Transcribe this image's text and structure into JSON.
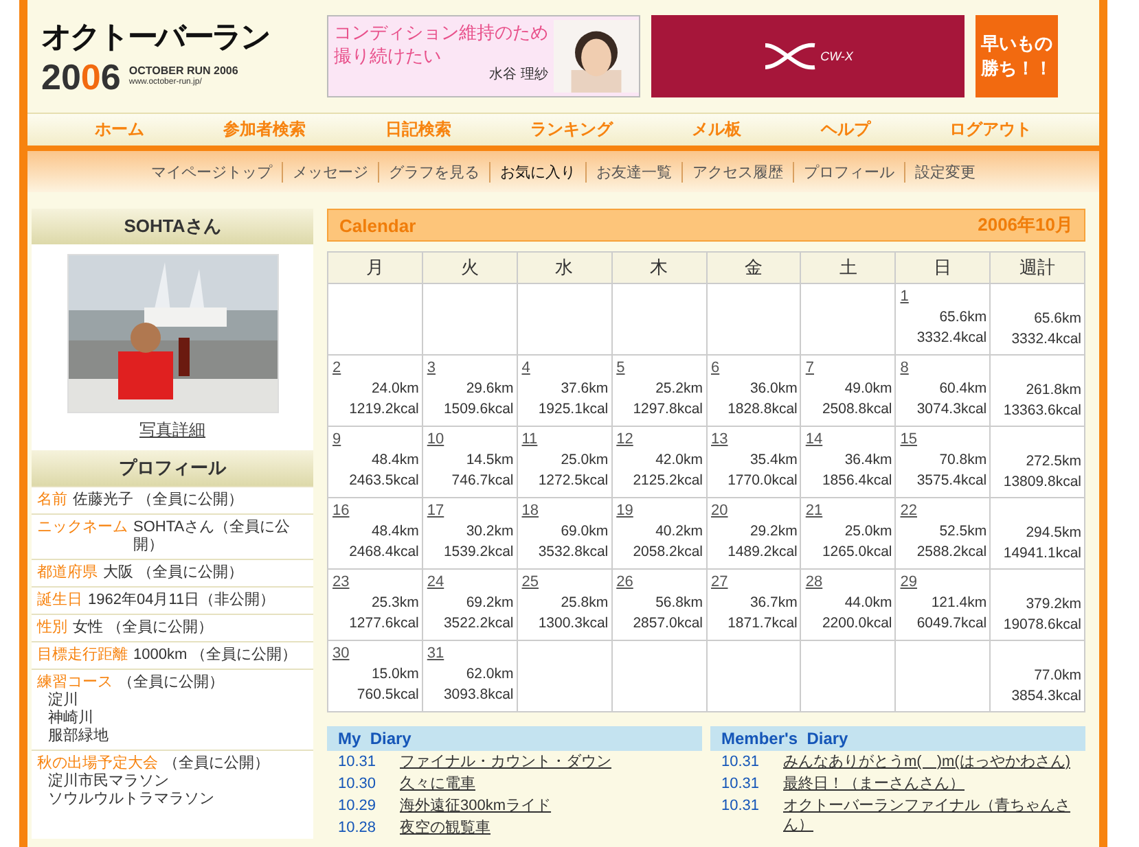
{
  "header": {
    "logo": {
      "title": "オクトーバーラン",
      "year_a": "20",
      "year_b": "0",
      "year_c": "6",
      "subtitle": "OCTOBER RUN 2006",
      "url": "www.october-run.jp/"
    },
    "ads": [
      {
        "kind": "photo_ad",
        "line1": "コンディション維持のため",
        "line2": "撮り続けたい",
        "name": "水谷 理紗"
      },
      {
        "kind": "brand_ad",
        "text": "CW-X"
      },
      {
        "kind": "promo_ad",
        "line1": "早いもの",
        "line2": "勝ち！！"
      }
    ]
  },
  "nav": [
    "ホーム",
    "参加者検索",
    "日記検索",
    "ランキング",
    "メル板",
    "ヘルプ",
    "ログアウト"
  ],
  "subnav": [
    {
      "label": "マイページトップ",
      "selected": false
    },
    {
      "label": "メッセージ",
      "selected": false
    },
    {
      "label": "グラフを見る",
      "selected": false
    },
    {
      "label": "お気に入り",
      "selected": true
    },
    {
      "label": "お友達一覧",
      "selected": false
    },
    {
      "label": "アクセス履歴",
      "selected": false
    },
    {
      "label": "プロフィール",
      "selected": false
    },
    {
      "label": "設定変更",
      "selected": false
    }
  ],
  "sidebar": {
    "user_title": "SOHTAさん",
    "photo_link": "写真詳細",
    "profile_title": "プロフィール",
    "profile": [
      {
        "label": "名前",
        "value": "佐藤光子 （全員に公開）"
      },
      {
        "label": "ニックネーム",
        "value": "SOHTAさん（全員に公開）"
      },
      {
        "label": "都道府県",
        "value": "大阪 （全員に公開）"
      },
      {
        "label": "誕生日",
        "value": "1962年04月11日（非公開）"
      },
      {
        "label": "性別",
        "value": "女性 （全員に公開）"
      },
      {
        "label": "目標走行距離",
        "value": "1000km （全員に公開）"
      },
      {
        "label": "練習コース",
        "value": "（全員に公開）",
        "lines": [
          "淀川",
          "神崎川",
          "服部緑地"
        ]
      },
      {
        "label": "秋の出場予定大会",
        "value": "（全員に公開）",
        "lines": [
          "淀川市民マラソン",
          "ソウルウルトラマラソン"
        ]
      }
    ]
  },
  "calendar": {
    "title": "Calendar",
    "month": "2006年10月",
    "columns": [
      "月",
      "火",
      "水",
      "木",
      "金",
      "土",
      "日",
      "週計"
    ],
    "weeks": [
      {
        "days": [
          {
            "kind": "blank"
          },
          {
            "kind": "blank"
          },
          {
            "kind": "blank"
          },
          {
            "kind": "blank"
          },
          {
            "kind": "blank"
          },
          {
            "kind": "blank"
          },
          {
            "kind": "day",
            "day": "1",
            "km": "65.6km",
            "kcal": "3332.4kcal"
          }
        ],
        "total": {
          "km": "65.6km",
          "kcal": "3332.4kcal"
        }
      },
      {
        "days": [
          {
            "day": "2",
            "km": "24.0km",
            "kcal": "1219.2kcal"
          },
          {
            "day": "3",
            "km": "29.6km",
            "kcal": "1509.6kcal"
          },
          {
            "day": "4",
            "km": "37.6km",
            "kcal": "1925.1kcal"
          },
          {
            "day": "5",
            "km": "25.2km",
            "kcal": "1297.8kcal"
          },
          {
            "day": "6",
            "km": "36.0km",
            "kcal": "1828.8kcal"
          },
          {
            "day": "7",
            "km": "49.0km",
            "kcal": "2508.8kcal"
          },
          {
            "day": "8",
            "km": "60.4km",
            "kcal": "3074.3kcal"
          }
        ],
        "total": {
          "km": "261.8km",
          "kcal": "13363.6kcal"
        }
      },
      {
        "days": [
          {
            "day": "9",
            "km": "48.4km",
            "kcal": "2463.5kcal"
          },
          {
            "day": "10",
            "km": "14.5km",
            "kcal": "746.7kcal"
          },
          {
            "day": "11",
            "km": "25.0km",
            "kcal": "1272.5kcal"
          },
          {
            "day": "12",
            "km": "42.0km",
            "kcal": "2125.2kcal"
          },
          {
            "day": "13",
            "km": "35.4km",
            "kcal": "1770.0kcal"
          },
          {
            "day": "14",
            "km": "36.4km",
            "kcal": "1856.4kcal"
          },
          {
            "day": "15",
            "km": "70.8km",
            "kcal": "3575.4kcal"
          }
        ],
        "total": {
          "km": "272.5km",
          "kcal": "13809.8kcal"
        }
      },
      {
        "days": [
          {
            "day": "16",
            "km": "48.4km",
            "kcal": "2468.4kcal"
          },
          {
            "day": "17",
            "km": "30.2km",
            "kcal": "1539.2kcal"
          },
          {
            "day": "18",
            "km": "69.0km",
            "kcal": "3532.8kcal"
          },
          {
            "day": "19",
            "km": "40.2km",
            "kcal": "2058.2kcal"
          },
          {
            "day": "20",
            "km": "29.2km",
            "kcal": "1489.2kcal"
          },
          {
            "day": "21",
            "km": "25.0km",
            "kcal": "1265.0kcal"
          },
          {
            "day": "22",
            "km": "52.5km",
            "kcal": "2588.2kcal"
          }
        ],
        "total": {
          "km": "294.5km",
          "kcal": "14941.1kcal"
        }
      },
      {
        "days": [
          {
            "day": "23",
            "km": "25.3km",
            "kcal": "1277.6kcal"
          },
          {
            "day": "24",
            "km": "69.2km",
            "kcal": "3522.2kcal"
          },
          {
            "day": "25",
            "km": "25.8km",
            "kcal": "1300.3kcal"
          },
          {
            "day": "26",
            "km": "56.8km",
            "kcal": "2857.0kcal"
          },
          {
            "day": "27",
            "km": "36.7km",
            "kcal": "1871.7kcal"
          },
          {
            "day": "28",
            "km": "44.0km",
            "kcal": "2200.0kcal"
          },
          {
            "day": "29",
            "km": "121.4km",
            "kcal": "6049.7kcal"
          }
        ],
        "total": {
          "km": "379.2km",
          "kcal": "19078.6kcal"
        }
      },
      {
        "days": [
          {
            "day": "30",
            "km": "15.0km",
            "kcal": "760.5kcal"
          },
          {
            "day": "31",
            "km": "62.0km",
            "kcal": "3093.8kcal"
          },
          {
            "kind": "blank"
          },
          {
            "kind": "blank"
          },
          {
            "kind": "blank"
          },
          {
            "kind": "blank"
          },
          {
            "kind": "blank"
          }
        ],
        "total": {
          "km": "77.0km",
          "kcal": "3854.3kcal"
        }
      }
    ]
  },
  "diaries": [
    {
      "title": "My  Diary",
      "entries": [
        {
          "date": "10.31",
          "title": "ファイナル・カウント・ダウン"
        },
        {
          "date": "10.30",
          "title": "久々に電車"
        },
        {
          "date": "10.29",
          "title": "海外遠征300kmライド"
        },
        {
          "date": "10.28",
          "title": "夜空の観覧車"
        }
      ]
    },
    {
      "title": "Member's  Diary",
      "entries": [
        {
          "date": "10.31",
          "title": "みんなありがとうm(　)m(はっやかわさん)"
        },
        {
          "date": "10.31",
          "title": "最終日！（まーさんさん）"
        },
        {
          "date": "10.31",
          "title": "オクトーバーランファイナル（青ちゃんさん）"
        }
      ]
    }
  ]
}
